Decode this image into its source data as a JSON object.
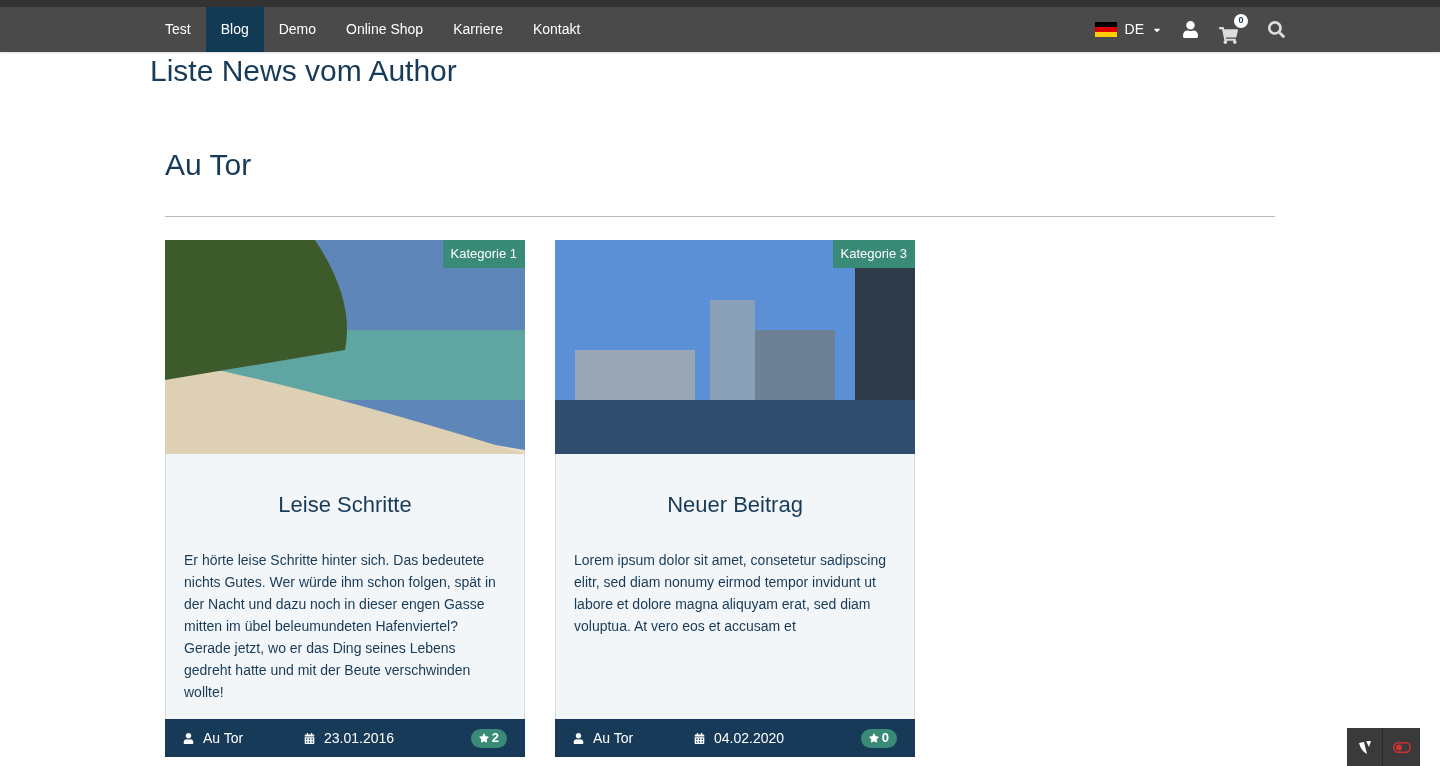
{
  "nav": {
    "items": [
      {
        "label": "Test",
        "selected": false
      },
      {
        "label": "Blog",
        "selected": true
      },
      {
        "label": "Demo",
        "selected": false
      },
      {
        "label": "Online Shop",
        "selected": false
      },
      {
        "label": "Karriere",
        "selected": false
      },
      {
        "label": "Kontakt",
        "selected": false
      }
    ],
    "language": "DE",
    "cart_count": "0"
  },
  "page_title": "Liste News vom Author",
  "author_heading": "Au Tor",
  "cards": [
    {
      "category": "Kategorie 1",
      "title": "Leise Schritte",
      "text": "Er hörte leise Schritte hinter sich. Das bedeutete nichts Gutes. Wer würde ihm schon folgen, spät in der Nacht und dazu noch in dieser engen Gasse mitten im übel beleumundeten Hafenviertel? Gerade jetzt, wo er das Ding seines Lebens gedreht hatte und mit der Beute verschwinden wollte!",
      "author": "Au Tor",
      "date": "23.01.2016",
      "stars_count": "2",
      "kind": "beach"
    },
    {
      "category": "Kategorie 3",
      "title": "Neuer Beitrag",
      "text": "Lorem ipsum dolor sit amet, consetetur sadipscing elitr, sed diam nonumy eirmod tempor invidunt ut labore et dolore magna aliquyam erat, sed diam voluptua. At vero eos et accusam et",
      "author": "Au Tor",
      "date": "04.02.2020",
      "stars_count": "0",
      "kind": "city"
    }
  ]
}
